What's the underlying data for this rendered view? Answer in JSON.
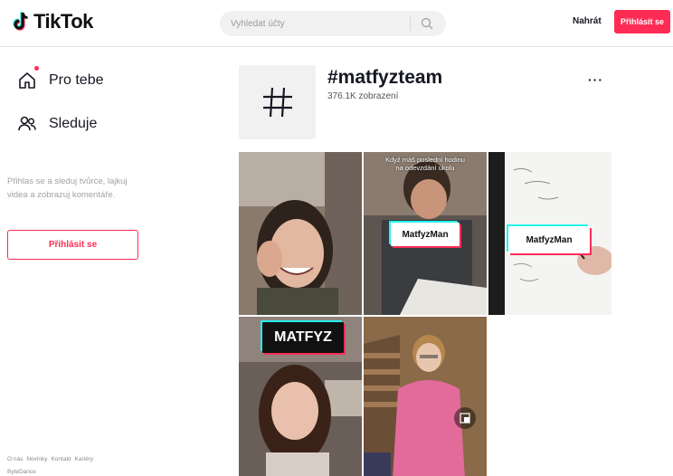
{
  "header": {
    "logo_text": "TikTok",
    "search_placeholder": "Vyhledat účty",
    "upload_label": "Nahrát",
    "login_label": "Přihlásit se"
  },
  "sidebar": {
    "items": [
      {
        "label": "Pro tebe",
        "icon": "home-icon",
        "active_dot": true
      },
      {
        "label": "Sleduje",
        "icon": "following-icon"
      }
    ],
    "login_hint": "Přihlas se a sleduj tvůrce, lajkuj videa a zobrazuj komentáře.",
    "login_button": "Přihlásit se",
    "footer_links": [
      "O nás",
      "Novinky",
      "Kontakt",
      "Kariéry"
    ],
    "footer_company": "ByteDance"
  },
  "hashtag": {
    "title": "#matfyzteam",
    "views": "376.1K zobrazení",
    "more_label": "···"
  },
  "videos": [
    {
      "id": 1,
      "overlay": ""
    },
    {
      "id": 2,
      "overlay": "Když máš poslední hodinu na odevzdání úkolu",
      "badge": "MatfyzMan"
    },
    {
      "id": 3,
      "badge": "MatfyzMan"
    },
    {
      "id": 4,
      "badge": "MATFYZ"
    },
    {
      "id": 5,
      "overlay": ""
    }
  ],
  "colors": {
    "accent": "#fe2c55",
    "cyan": "#25f4ee",
    "text": "#161823",
    "muted": "#a1a2a7"
  }
}
